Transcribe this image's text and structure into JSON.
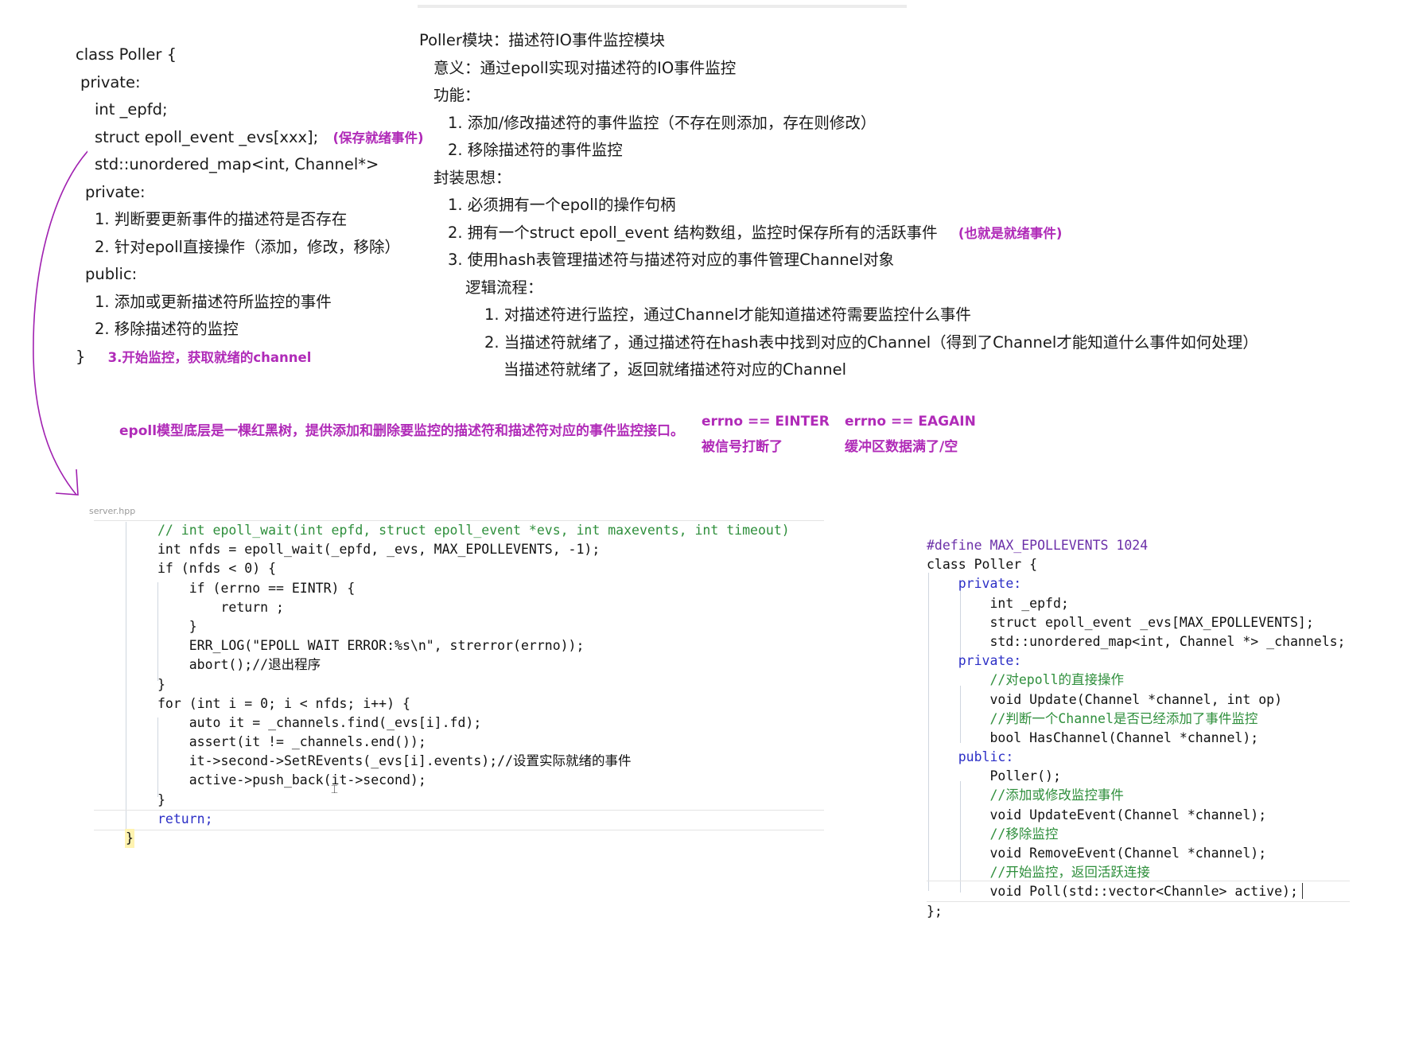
{
  "left_notes": {
    "lines": [
      "class Poller {",
      " private:",
      "    int _epfd;",
      "    struct epoll_event _evs[xxx];",
      "    std::unordered_map<int, Channel*>",
      "  private:",
      "    1. 判断要更新事件的描述符是否存在",
      "    2. 针对epoll直接操作（添加，修改，移除）",
      "  public:",
      "    1. 添加或更新描述符所监控的事件",
      "    2. 移除描述符的监控",
      "}"
    ],
    "annotation_ready": "(保存就绪事件)",
    "annotation_start": "3.开始监控，获取就绪的channel"
  },
  "right_notes": {
    "lines": [
      "Poller模块：描述符IO事件监控模块",
      "意义：通过epoll实现对描述符的IO事件监控",
      "功能：",
      "1. 添加/修改描述符的事件监控（不存在则添加，存在则修改）",
      "2. 移除描述符的事件监控",
      "封装思想：",
      "1. 必须拥有一个epoll的操作句柄",
      "2. 拥有一个struct epoll_event 结构数组，监控时保存所有的活跃事件",
      "3. 使用hash表管理描述符与描述符对应的事件管理Channel对象",
      "逻辑流程：",
      "1. 对描述符进行监控，通过Channel才能知道描述符需要监控什么事件",
      "2. 当描述符就绪了，通过描述符在hash表中找到对应的Channel（得到了Channel才能知道什么事件如何处理）",
      "当描述符就绪了，返回就绪描述符对应的Channel"
    ],
    "annotation_ready": "(也就是就绪事件)"
  },
  "middle_notes": {
    "epoll_note": "epoll模型底层是一棵红黑树，提供添加和删除要监控的描述符和描述符对应的事件监控接口。",
    "eintr_title": "errno == EINTER",
    "eintr_desc": "被信号打断了",
    "eagain_title": "errno == EAGAIN",
    "eagain_desc": "缓冲区数据满了/空"
  },
  "left_code": {
    "tab_label": "server.hpp",
    "lines": [
      "// int epoll_wait(int epfd, struct epoll_event *evs, int maxevents, int timeout)",
      "int nfds = epoll_wait(_epfd, _evs, MAX_EPOLLEVENTS, -1);",
      "if (nfds < 0) {",
      "    if (errno == EINTR) {",
      "        return ;",
      "    }",
      "    ERR_LOG(\"EPOLL WAIT ERROR:%s\\n\", strerror(errno));",
      "    abort();//退出程序",
      "}",
      "for (int i = 0; i < nfds; i++) {",
      "    auto it = _channels.find(_evs[i].fd);",
      "    assert(it != _channels.end());",
      "    it->second->SetREvents(_evs[i].events);//设置实际就绪的事件",
      "    active->push_back(it->second);",
      "}",
      "return;",
      "}"
    ]
  },
  "right_code": {
    "lines": [
      "#define MAX_EPOLLEVENTS 1024",
      "class Poller {",
      "    private:",
      "        int _epfd;",
      "        struct epoll_event _evs[MAX_EPOLLEVENTS];",
      "        std::unordered_map<int, Channel *> _channels;",
      "    private:",
      "        //对epoll的直接操作",
      "        void Update(Channel *channel, int op)",
      "        //判断一个Channel是否已经添加了事件监控",
      "        bool HasChannel(Channel *channel);",
      "    public:",
      "        Poller();",
      "        //添加或修改监控事件",
      "        void UpdateEvent(Channel *channel);",
      "        //移除监控",
      "        void RemoveEvent(Channel *channel);",
      "        //开始监控，返回活跃连接",
      "        void Poll(std::vector<Channle> active);",
      "};"
    ]
  }
}
